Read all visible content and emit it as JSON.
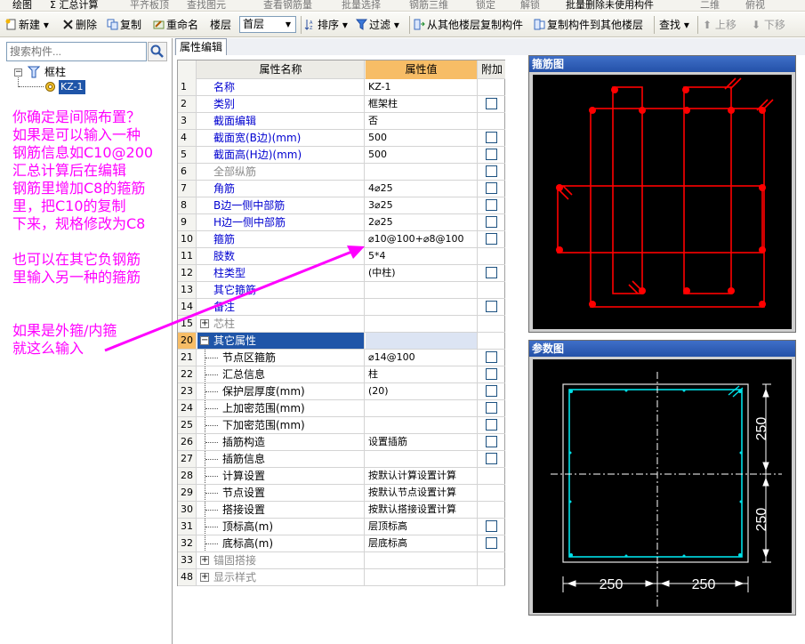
{
  "menubar": {
    "items": [
      "绘图",
      "Σ 汇总计算",
      "平齐板顶",
      "查找图元",
      "查看钢筋量",
      "批量选择",
      "钢筋三维",
      "锁定",
      "解锁",
      "批量删除未使用构件",
      "二维",
      "俯视"
    ]
  },
  "toolbar": {
    "new": "新建",
    "delete": "删除",
    "copy": "复制",
    "rename": "重命名",
    "floor_label": "楼层",
    "floor_value": "首层",
    "sort": "排序",
    "filter": "过滤",
    "copy_from_floor": "从其他楼层复制构件",
    "copy_to_floor": "复制构件到其他楼层",
    "find": "查找",
    "move_up": "上移",
    "move_down": "下移"
  },
  "left_panel": {
    "search_placeholder": "搜索构件...",
    "tree_root": "框柱",
    "tree_child": "KZ-1"
  },
  "tab": {
    "label": "属性编辑"
  },
  "grid": {
    "headers": {
      "name": "属性名称",
      "value": "属性值",
      "extra": "附加"
    },
    "rows": [
      {
        "n": "1",
        "name": "名称",
        "value": "KZ-1",
        "check": false
      },
      {
        "n": "2",
        "name": "类别",
        "value": "框架柱",
        "check": true
      },
      {
        "n": "3",
        "name": "截面编辑",
        "value": "否",
        "check": false
      },
      {
        "n": "4",
        "name": "截面宽(B边)(mm)",
        "value": "500",
        "check": true
      },
      {
        "n": "5",
        "name": "截面高(H边)(mm)",
        "value": "500",
        "check": true
      },
      {
        "n": "6",
        "name": "全部纵筋",
        "value": "",
        "check": true
      },
      {
        "n": "7",
        "name": "角筋",
        "value": "4⌀25",
        "check": true
      },
      {
        "n": "8",
        "name": "B边一侧中部筋",
        "value": "3⌀25",
        "check": true
      },
      {
        "n": "9",
        "name": "H边一侧中部筋",
        "value": "2⌀25",
        "check": true
      },
      {
        "n": "10",
        "name": "箍筋",
        "value": "⌀10@100+⌀8@100",
        "check": true
      },
      {
        "n": "11",
        "name": "肢数",
        "value": "5*4",
        "check": false
      },
      {
        "n": "12",
        "name": "柱类型",
        "value": "(中柱)",
        "check": true
      },
      {
        "n": "13",
        "name": "其它箍筋",
        "value": "",
        "check": false
      },
      {
        "n": "14",
        "name": "备注",
        "value": "",
        "check": true
      },
      {
        "n": "15",
        "name": "芯柱",
        "value": "",
        "check": false
      },
      {
        "n": "20",
        "name": "其它属性",
        "value": "",
        "check": false
      },
      {
        "n": "21",
        "name": "节点区箍筋",
        "value": "⌀14@100",
        "check": true
      },
      {
        "n": "22",
        "name": "汇总信息",
        "value": "柱",
        "check": true
      },
      {
        "n": "23",
        "name": "保护层厚度(mm)",
        "value": "(20)",
        "check": true
      },
      {
        "n": "24",
        "name": "上加密范围(mm)",
        "value": "",
        "check": true
      },
      {
        "n": "25",
        "name": "下加密范围(mm)",
        "value": "",
        "check": true
      },
      {
        "n": "26",
        "name": "插筋构造",
        "value": "设置插筋",
        "check": true
      },
      {
        "n": "27",
        "name": "插筋信息",
        "value": "",
        "check": true
      },
      {
        "n": "28",
        "name": "计算设置",
        "value": "按默认计算设置计算",
        "check": false
      },
      {
        "n": "29",
        "name": "节点设置",
        "value": "按默认节点设置计算",
        "check": false
      },
      {
        "n": "30",
        "name": "搭接设置",
        "value": "按默认搭接设置计算",
        "check": false
      },
      {
        "n": "31",
        "name": "顶标高(m)",
        "value": "层顶标高",
        "check": true
      },
      {
        "n": "32",
        "name": "底标高(m)",
        "value": "层底标高",
        "check": true
      },
      {
        "n": "33",
        "name": "锚固搭接",
        "value": "",
        "check": false
      },
      {
        "n": "48",
        "name": "显示样式",
        "value": "",
        "check": false
      }
    ]
  },
  "stirrup_panel": {
    "title": "箍筋图"
  },
  "param_panel": {
    "title": "参数图",
    "dim_v1": "250",
    "dim_v2": "250",
    "dim_h1": "250",
    "dim_h2": "250"
  },
  "annotations": {
    "line1": "你确定是间隔布置？",
    "line2": "如果是可以输入一种",
    "line3": "钢筋信息如C10@200",
    "line4": "汇总计算后在编辑",
    "line5": "钢筋里增加C8的箍筋",
    "line6": "里，把C10的复制",
    "line7": "下来，规格修改为C8",
    "line8": "也可以在其它负钢筋",
    "line9": "里输入另一种的箍筋",
    "line10": "如果是外箍/内箍",
    "line11": "就这么输入"
  },
  "colors": {
    "annotation": "#ff00ff",
    "rebar": "#ff0000",
    "param": "#00e0e8",
    "selected": "#1f55a8",
    "header_value": "#f7bd66"
  }
}
